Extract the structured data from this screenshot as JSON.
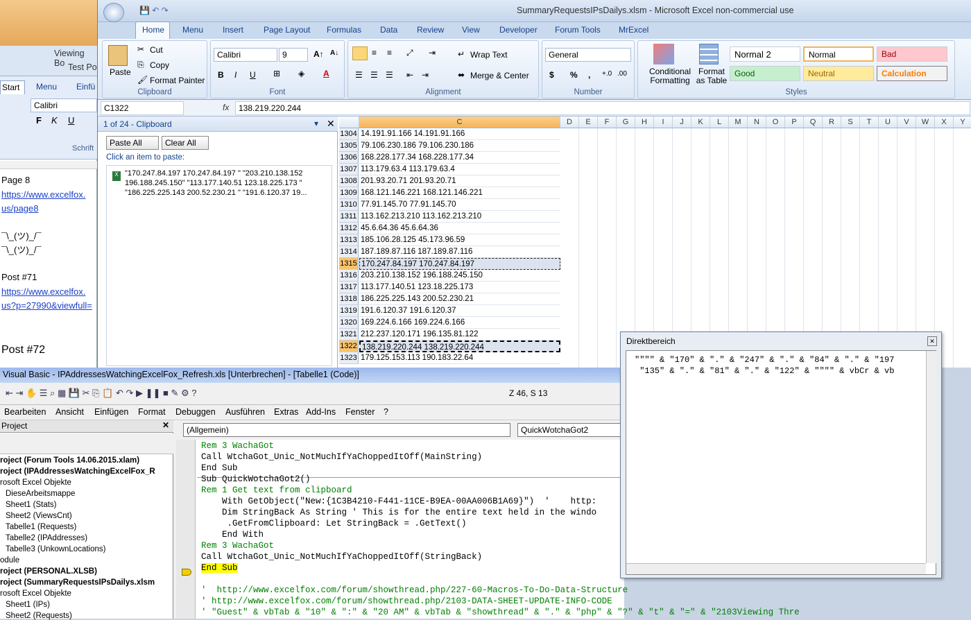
{
  "word_bg": {
    "title": "Viewing Bo",
    "title2": "Test Po",
    "tab_start": "Start",
    "tab_menu": "Menu",
    "tab_einf": "Einfü",
    "font": "Calibri",
    "schrift": "Schrift",
    "page8": "Page 8",
    "link1a": "https://www.excelfox.",
    "link1b": "us/page8",
    "shrug": "¯\\_(ツ)_/¯",
    "post71": "Post #71",
    "link2a": "https://www.excelfox.",
    "link2b": "us?p=27990&viewfull=",
    "post72": "Post #72"
  },
  "excel": {
    "title": "SummaryRequestsIPsDailys.xlsm - Microsoft Excel non-commercial use",
    "tabs": [
      "Home",
      "Menu",
      "Insert",
      "Page Layout",
      "Formulas",
      "Data",
      "Review",
      "View",
      "Developer",
      "Forum Tools",
      "MrExcel"
    ],
    "clipboard": {
      "paste": "Paste",
      "cut": "Cut",
      "copy": "Copy",
      "format_painter": "Format Painter",
      "label": "Clipboard"
    },
    "font": {
      "name": "Calibri",
      "size": "9",
      "label": "Font",
      "bold": "B",
      "italic": "I",
      "underline": "U"
    },
    "alignment": {
      "wrap": "Wrap Text",
      "merge": "Merge & Center",
      "label": "Alignment"
    },
    "number": {
      "format": "General",
      "dollar": "$",
      "percent": "%",
      "comma": ",",
      "label": "Number"
    },
    "styles": {
      "cond": "Conditional Formatting",
      "fmt_table": "Format as Table",
      "normal2": "Normal 2",
      "normal": "Normal",
      "bad": "Bad",
      "good": "Good",
      "neutral": "Neutral",
      "calculation": "Calculation",
      "label": "Styles"
    },
    "namebox": "C1322",
    "fx": "fx",
    "formula": "138.219.220.244",
    "pane": {
      "header": "1 of 24 - Clipboard",
      "paste_all": "Paste All",
      "clear_all": "Clear All",
      "hint": "Click an item to paste:",
      "item1": "\"170.247.84.197 170.247.84.197 \" \"203.210.138.152",
      "item2": "196.188.245.150\" \"113.177.140.51 123.18.225.173 \"",
      "item3": "\"186.225.225.143 200.52.230.21 \" \"191.6.120.37 19..."
    },
    "columns": [
      "C",
      "D",
      "E",
      "F",
      "G",
      "H",
      "I",
      "J",
      "K",
      "L",
      "M",
      "N",
      "O",
      "P",
      "Q",
      "R",
      "S",
      "T",
      "U",
      "V",
      "W",
      "X",
      "Y"
    ],
    "rows": [
      {
        "n": "1304",
        "v": "14.191.91.166 14.191.91.166"
      },
      {
        "n": "1305",
        "v": "79.106.230.186 79.106.230.186"
      },
      {
        "n": "1306",
        "v": "168.228.177.34 168.228.177.34"
      },
      {
        "n": "1307",
        "v": "113.179.63.4 113.179.63.4"
      },
      {
        "n": "1308",
        "v": "201.93.20.71 201.93.20.71"
      },
      {
        "n": "1309",
        "v": "168.121.146.221 168.121.146.221"
      },
      {
        "n": "1310",
        "v": "77.91.145.70 77.91.145.70"
      },
      {
        "n": "1311",
        "v": "113.162.213.210 113.162.213.210"
      },
      {
        "n": "1312",
        "v": "45.6.64.36 45.6.64.36"
      },
      {
        "n": "1313",
        "v": "185.106.28.125 45.173.96.59"
      },
      {
        "n": "1314",
        "v": "187.189.87.116 187.189.87.116"
      },
      {
        "n": "1315",
        "v": "170.247.84.197 170.247.84.197"
      },
      {
        "n": "1316",
        "v": "203.210.138.152 196.188.245.150"
      },
      {
        "n": "1317",
        "v": "113.177.140.51 123.18.225.173"
      },
      {
        "n": "1318",
        "v": "186.225.225.143 200.52.230.21"
      },
      {
        "n": "1319",
        "v": "191.6.120.37 191.6.120.37"
      },
      {
        "n": "1320",
        "v": "169.224.6.166 169.224.6.166"
      },
      {
        "n": "1321",
        "v": "212.237.120.171 196.135.81.122"
      },
      {
        "n": "1322",
        "v": "138.219.220.244 138.219.220.244"
      },
      {
        "n": "1323",
        "v": "179.125.153.113 190.183.22.64"
      }
    ]
  },
  "vbe": {
    "title": "Visual Basic - IPAddressesWatchingExcelFox_Refresh.xls [Unterbrechen] - [Tabelle1 (Code)]",
    "pos": "Z 46, S 13",
    "menus": [
      "Bearbeiten",
      "Ansicht",
      "Einfügen",
      "Format",
      "Debuggen",
      "Ausführen",
      "Extras",
      "Add-Ins",
      "Fenster",
      "?"
    ],
    "proj_title": "Project",
    "combo_left": "(Allgemein)",
    "combo_right": "QuickWotchaGot2",
    "tree": [
      "roject (Forum Tools 14.06.2015.xlam)",
      "roject (IPAddressesWatchingExcelFox_R",
      "rosoft Excel Objekte",
      "DieseArbeitsmappe",
      "Sheet1 (Stats)",
      "Sheet2 (ViewsCnt)",
      "Tabelle1 (Requests)",
      "Tabelle2 (IPAddresses)",
      "Tabelle3 (UnkownLocations)",
      "odule",
      "roject (PERSONAL.XLSB)",
      "roject (SummaryRequestsIPsDailys.xlsm",
      "rosoft Excel Objekte",
      "Sheet1 (IPs)",
      "Sheet2 (Requests)"
    ],
    "code": [
      "Rem 3 WachaGot",
      "Call WtchaGot_Unic_NotMuchIfYaChoppedItOff(MainString)",
      "End Sub",
      "Sub QuickWotchaGot2()",
      "Rem 1 Get text from clipboard",
      "    With GetObject(\"New:{1C3B4210-F441-11CE-B9EA-00AA006B1A69}\")  '    http:",
      "    Dim StringBack As String ' This is for the entire text held in the windo",
      "     .GetFromClipboard: Let StringBack = .GetText()",
      "    End With",
      "Rem 3 WachaGot",
      "Call WtchaGot_Unic_NotMuchIfYaChoppedItOff(StringBack)",
      "End Sub",
      "",
      "'  http://www.excelfox.com/forum/showthread.php/227-60-Macros-To-Do-Data-Structure",
      "' http://www.excelfox.com/forum/showthread.php/2103-DATA-SHEET-UPDATE-INFO-CODE",
      "' \"Guest\" & vbTab & \"10\" & \":\" & \"20 AM\" & vbTab & \"showthread\" & \".\" & \"php\" & \"?\" & \"t\" & \"=\" & \"2103Viewing Thre"
    ]
  },
  "immediate": {
    "title": "Direktbereich",
    "line1": "\"\"\"\" & \"170\" & \".\" & \"247\" & \".\" & \"84\" & \".\" & \"197",
    "line2": " \"135\" & \".\" & \"81\" & \".\" & \"122\" & \"\"\"\" & vbCr & vb"
  }
}
